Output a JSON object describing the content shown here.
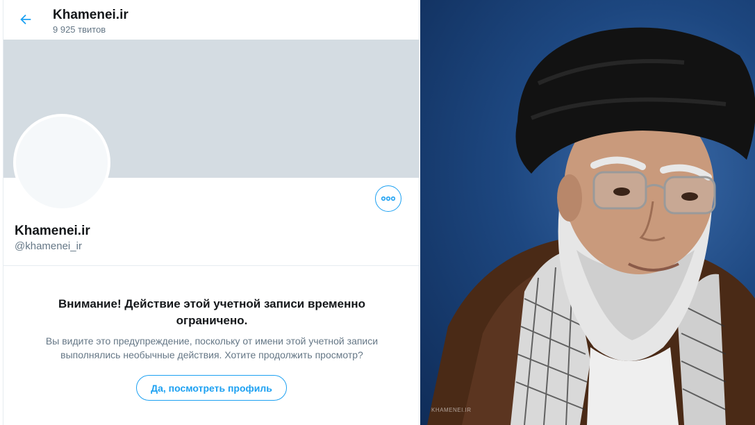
{
  "header": {
    "title": "Khamenei.ir",
    "tweet_count": "9 925 твитов"
  },
  "profile": {
    "name": "Khamenei.ir",
    "handle": "@khamenei_ir"
  },
  "warning": {
    "title": "Внимание! Действие этой учетной записи временно ограничено.",
    "text": "Вы видите это предупреждение, поскольку от имени этой учетной записи выполнялись необычные действия. Хотите продолжить просмотр?",
    "button_label": "Да, посмотреть профиль"
  },
  "photo": {
    "watermark": "KHAMENEI.IR"
  },
  "icons": {
    "back": "arrow-left-icon",
    "more": "more-dots-icon"
  },
  "colors": {
    "accent": "#1da1f2",
    "banner": "#ccd6dd",
    "secondary_text": "#657786"
  }
}
